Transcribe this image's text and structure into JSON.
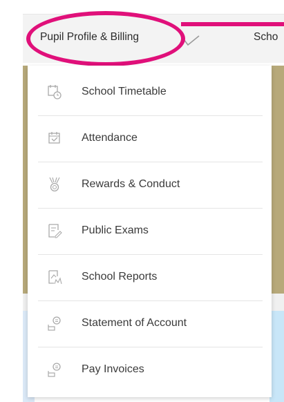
{
  "nav": {
    "main_label": "Pupil Profile & Billing",
    "next_label": "Scho"
  },
  "menu": {
    "items": [
      {
        "label": "School Timetable",
        "icon": "calendar-clock-icon"
      },
      {
        "label": "Attendance",
        "icon": "calendar-check-icon"
      },
      {
        "label": "Rewards & Conduct",
        "icon": "medal-icon"
      },
      {
        "label": "Public Exams",
        "icon": "exam-paper-icon"
      },
      {
        "label": "School Reports",
        "icon": "report-icon"
      },
      {
        "label": "Statement of Account",
        "icon": "account-icon"
      },
      {
        "label": "Pay Invoices",
        "icon": "invoice-icon"
      }
    ]
  },
  "colors": {
    "highlight": "#e0107a",
    "banner_gold": "#b7a97a",
    "icon_gray": "#a9a9a9"
  }
}
